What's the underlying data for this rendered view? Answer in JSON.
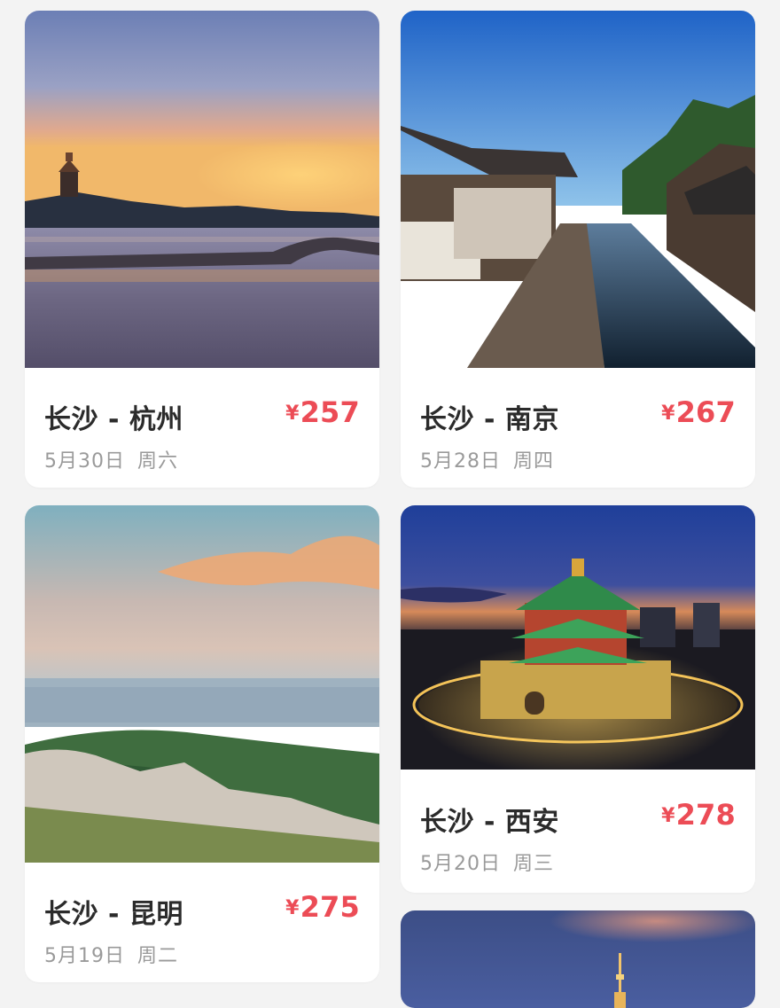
{
  "currency_symbol": "¥",
  "colors": {
    "price": "#ec4c56",
    "route_text": "#2b2b2b",
    "date_text": "#9a9a9a",
    "background": "#f3f3f3",
    "card": "#ffffff"
  },
  "deals": [
    {
      "route": "长沙 - 杭州",
      "price": "257",
      "date": "5月30日",
      "weekday": "周六",
      "image": "west-lake-pagoda-sunset-photo"
    },
    {
      "route": "长沙 - 南京",
      "price": "267",
      "date": "5月28日",
      "weekday": "周四",
      "image": "water-town-canal-photo"
    },
    {
      "route": "长沙 - 昆明",
      "price": "275",
      "date": "5月19日",
      "weekday": "周二",
      "image": "mountain-city-view-photo"
    },
    {
      "route": "长沙 - 西安",
      "price": "278",
      "date": "5月20日",
      "weekday": "周三",
      "image": "bell-tower-night-photo"
    },
    {
      "image": "tower-dusk-photo"
    }
  ]
}
